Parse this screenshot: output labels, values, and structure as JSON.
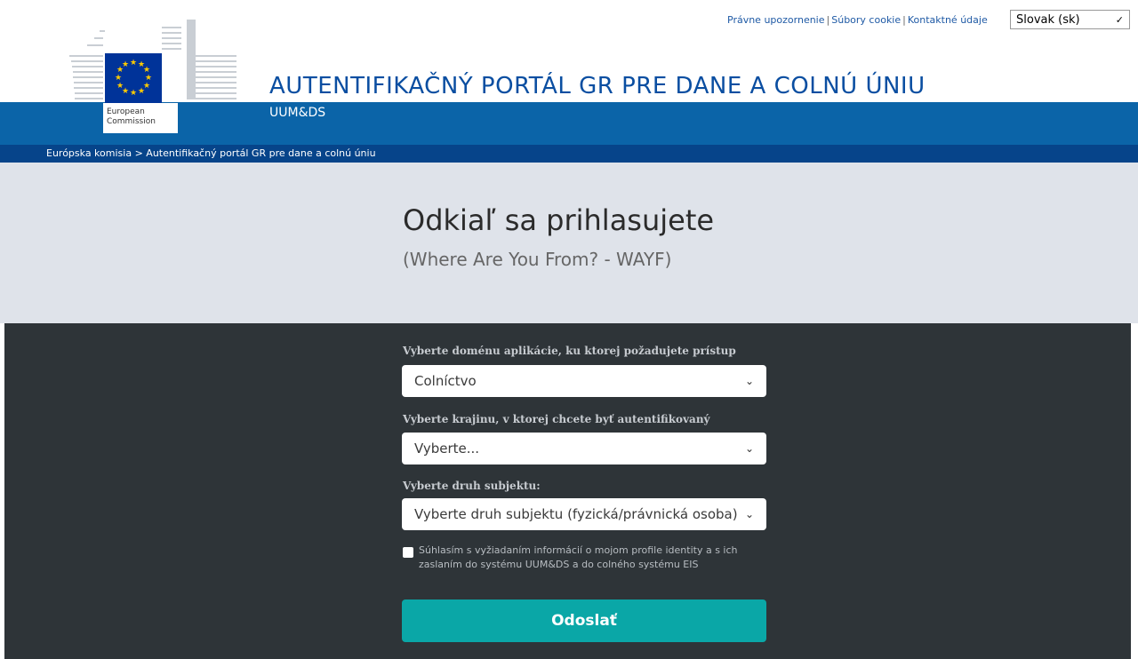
{
  "top_links": {
    "legal_notice": "Právne upozornenie",
    "cookies": "Súbory cookie",
    "contact": "Kontaktné údaje",
    "separator": "|"
  },
  "language": {
    "selected": "Slovak (sk)"
  },
  "logo": {
    "line1": "European",
    "line2": "Commission"
  },
  "header": {
    "title": "AUTENTIFIKAČNÝ PORTÁL GR PRE DANE A COLNÚ ÚNIU",
    "subtitle": "UUM&DS"
  },
  "breadcrumb": {
    "item1": "Európska komisia",
    "separator": ">",
    "item2": "Autentifikačný portál GR pre dane a colnú úniu"
  },
  "hero": {
    "title": "Odkiaľ sa prihlasujete",
    "subtitle": "(Where Are You From? - WAYF)"
  },
  "form": {
    "domain_label": "Vyberte doménu aplikácie, ku ktorej požadujete prístup",
    "domain_value": "Colníctvo",
    "country_label": "Vyberte krajinu, v ktorej chcete byť autentifikovaný",
    "country_value": "Vyberte...",
    "subject_label": "Vyberte druh subjektu:",
    "subject_value": "Vyberte druh subjektu (fyzická/právnická osoba)",
    "consent_text": "Súhlasím s vyžiadaním informácií o mojom profile identity a s ich zaslaním do systému UUM&DS a do colného systému EIS",
    "consent_checked": false,
    "submit_label": "Odoslať"
  },
  "colors": {
    "brand_blue": "#0b64a8",
    "breadcrumb_blue": "#06448a",
    "title_blue": "#0a4ea1",
    "hero_bg": "#dfe3ea",
    "dark_bg": "#2e3438",
    "submit_teal": "#0aa7a7",
    "eu_blue": "#003399",
    "eu_star": "#ffcc00"
  }
}
